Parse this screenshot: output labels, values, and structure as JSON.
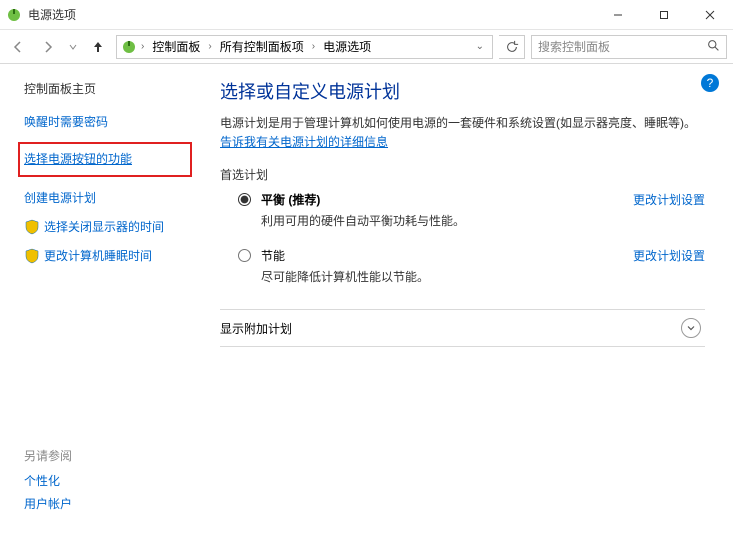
{
  "window": {
    "title": "电源选项"
  },
  "breadcrumbs": {
    "items": [
      "控制面板",
      "所有控制面板项",
      "电源选项"
    ]
  },
  "search": {
    "placeholder": "搜索控制面板"
  },
  "sidebar": {
    "home": "控制面板主页",
    "links": [
      {
        "label": "唤醒时需要密码",
        "icon": false,
        "highlight": false
      },
      {
        "label": "选择电源按钮的功能",
        "icon": false,
        "highlight": true
      },
      {
        "label": "创建电源计划",
        "icon": false,
        "highlight": false
      },
      {
        "label": "选择关闭显示器的时间",
        "icon": true,
        "highlight": false
      },
      {
        "label": "更改计算机睡眠时间",
        "icon": true,
        "highlight": false
      }
    ],
    "see_also_header": "另请参阅",
    "see_also": [
      "个性化",
      "用户帐户"
    ]
  },
  "content": {
    "heading": "选择或自定义电源计划",
    "desc_prefix": "电源计划是用于管理计算机如何使用电源的一套硬件和系统设置(如显示器亮度、睡眠等)。",
    "desc_link": "告诉我有关电源计划的详细信息",
    "preferred_label": "首选计划",
    "plans": [
      {
        "title": "平衡 (推荐)",
        "sub": "利用可用的硬件自动平衡功耗与性能。",
        "selected": true,
        "action": "更改计划设置"
      },
      {
        "title": "节能",
        "sub": "尽可能降低计算机性能以节能。",
        "selected": false,
        "action": "更改计划设置"
      }
    ],
    "extra_label": "显示附加计划"
  }
}
